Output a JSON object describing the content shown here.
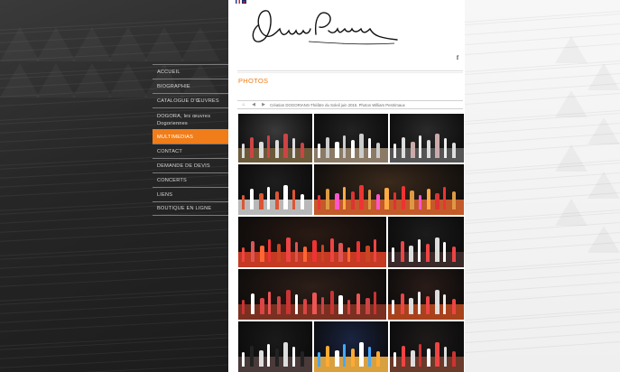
{
  "site": {
    "signature_text": "Étienne Perruchon",
    "flags": [
      "french-flag-icon",
      "english-flag-icon"
    ],
    "facebook_icon": "f"
  },
  "nav": {
    "items": [
      {
        "label": "ACCUEIL",
        "active": false
      },
      {
        "label": "BIOGRAPHIE",
        "active": false
      },
      {
        "label": "CATALOGUE D'ŒUVRES",
        "active": false
      },
      {
        "label": "DOGORA, les œuvres Dogoriennes",
        "active": false
      },
      {
        "label": "MULTIMEDIAS",
        "active": true
      },
      {
        "label": "CONTACT",
        "active": false
      },
      {
        "label": "DEMANDE DE DEVIS",
        "active": false
      },
      {
        "label": "CONCERTS",
        "active": false
      },
      {
        "label": "LIENS",
        "active": false
      },
      {
        "label": "BOUTIQUE EN LIGNE",
        "active": false
      }
    ]
  },
  "page": {
    "title": "PHOTOS",
    "breadcrumb_caption": "Création DOGORIANS-Théâtre du Soleil juin 2015. Photos William Pestrimaux",
    "breadcrumb_icons": [
      "home-icon",
      "back-arrow-icon",
      "forward-arrow-icon"
    ]
  },
  "colors": {
    "accent": "#f07d19",
    "nav_text": "#d8d8d8",
    "dark_bg": "#262626"
  },
  "gallery": [
    {
      "name": "photo-singers-stage",
      "hue": "#3a3a3a",
      "stage": "#6b5a3a",
      "figs": [
        "#ddd",
        "#c44"
      ]
    },
    {
      "name": "photo-conductor-rehearsal",
      "hue": "#222",
      "stage": "#8a7a66",
      "figs": [
        "#fff",
        "#ccc"
      ]
    },
    {
      "name": "photo-conductor-raised-arms",
      "hue": "#2a2a2a",
      "stage": "#555",
      "figs": [
        "#eee",
        "#ddd",
        "#caa"
      ]
    },
    {
      "name": "photo-piano-score",
      "hue": "#1e1e1e",
      "stage": "#b8b8b8",
      "figs": [
        "#d53",
        "#fff"
      ]
    },
    {
      "name": "photo-choir-costumes-wide",
      "hue": "#3b2a1c",
      "stage": "#c25a2a",
      "figs": [
        "#e33",
        "#d94",
        "#f5c",
        "#fa4",
        "#d33"
      ]
    },
    {
      "name": "photo-choir-red-large",
      "hue": "#2a1a14",
      "stage": "#c43a22",
      "figs": [
        "#e44",
        "#d55",
        "#f63",
        "#e33",
        "#c42"
      ]
    },
    {
      "name": "photo-performers-close",
      "hue": "#1c1c1c",
      "stage": "#3a2a2a",
      "figs": [
        "#fff",
        "#e44",
        "#ddd"
      ]
    },
    {
      "name": "photo-singers-row",
      "hue": "#2d1e18",
      "stage": "#7a3020",
      "figs": [
        "#c33",
        "#fff",
        "#d44",
        "#e55",
        "#c44"
      ]
    },
    {
      "name": "photo-stage-red-floor",
      "hue": "#2a1c18",
      "stage": "#a8421c",
      "figs": [
        "#eee",
        "#e44",
        "#ddd"
      ]
    },
    {
      "name": "photo-soloists-bow",
      "hue": "#1a1a1a",
      "stage": "#4a3a3a",
      "figs": [
        "#fff",
        "#222",
        "#ddd"
      ]
    },
    {
      "name": "photo-blue-stage-ensemble",
      "hue": "#1a2440",
      "stage": "#d9a040",
      "figs": [
        "#4af",
        "#fa3",
        "#fff"
      ]
    },
    {
      "name": "photo-finale-crowd",
      "hue": "#1e1a1a",
      "stage": "#6a3a2a",
      "figs": [
        "#fff",
        "#e44",
        "#ddd",
        "#c33"
      ]
    }
  ]
}
